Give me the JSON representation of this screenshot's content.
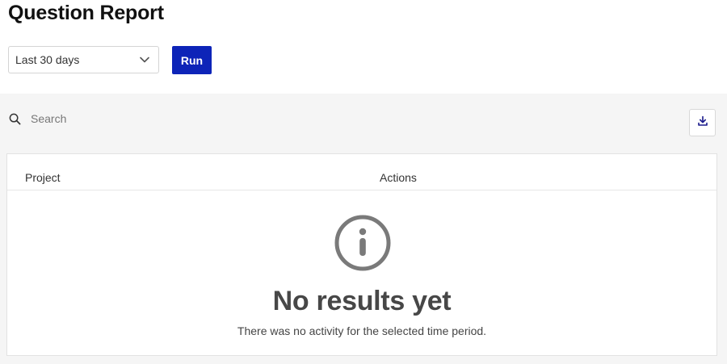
{
  "page": {
    "title": "Question Report"
  },
  "filters": {
    "date_range": {
      "selected": "Last 30 days"
    },
    "run_label": "Run"
  },
  "search": {
    "placeholder": "Search",
    "value": ""
  },
  "table": {
    "columns": [
      "Project",
      "Actions"
    ]
  },
  "empty_state": {
    "title": "No results yet",
    "message": "There was no activity for the selected time period."
  },
  "colors": {
    "primary": "#0d24b8",
    "panel_bg": "#f5f5f5",
    "icon_gray": "#7a7a7a",
    "download_icon": "#1a1a8c"
  },
  "icons": {
    "search": "search-icon",
    "download": "download-icon",
    "chevron": "chevron-down-icon",
    "info": "info-icon"
  }
}
